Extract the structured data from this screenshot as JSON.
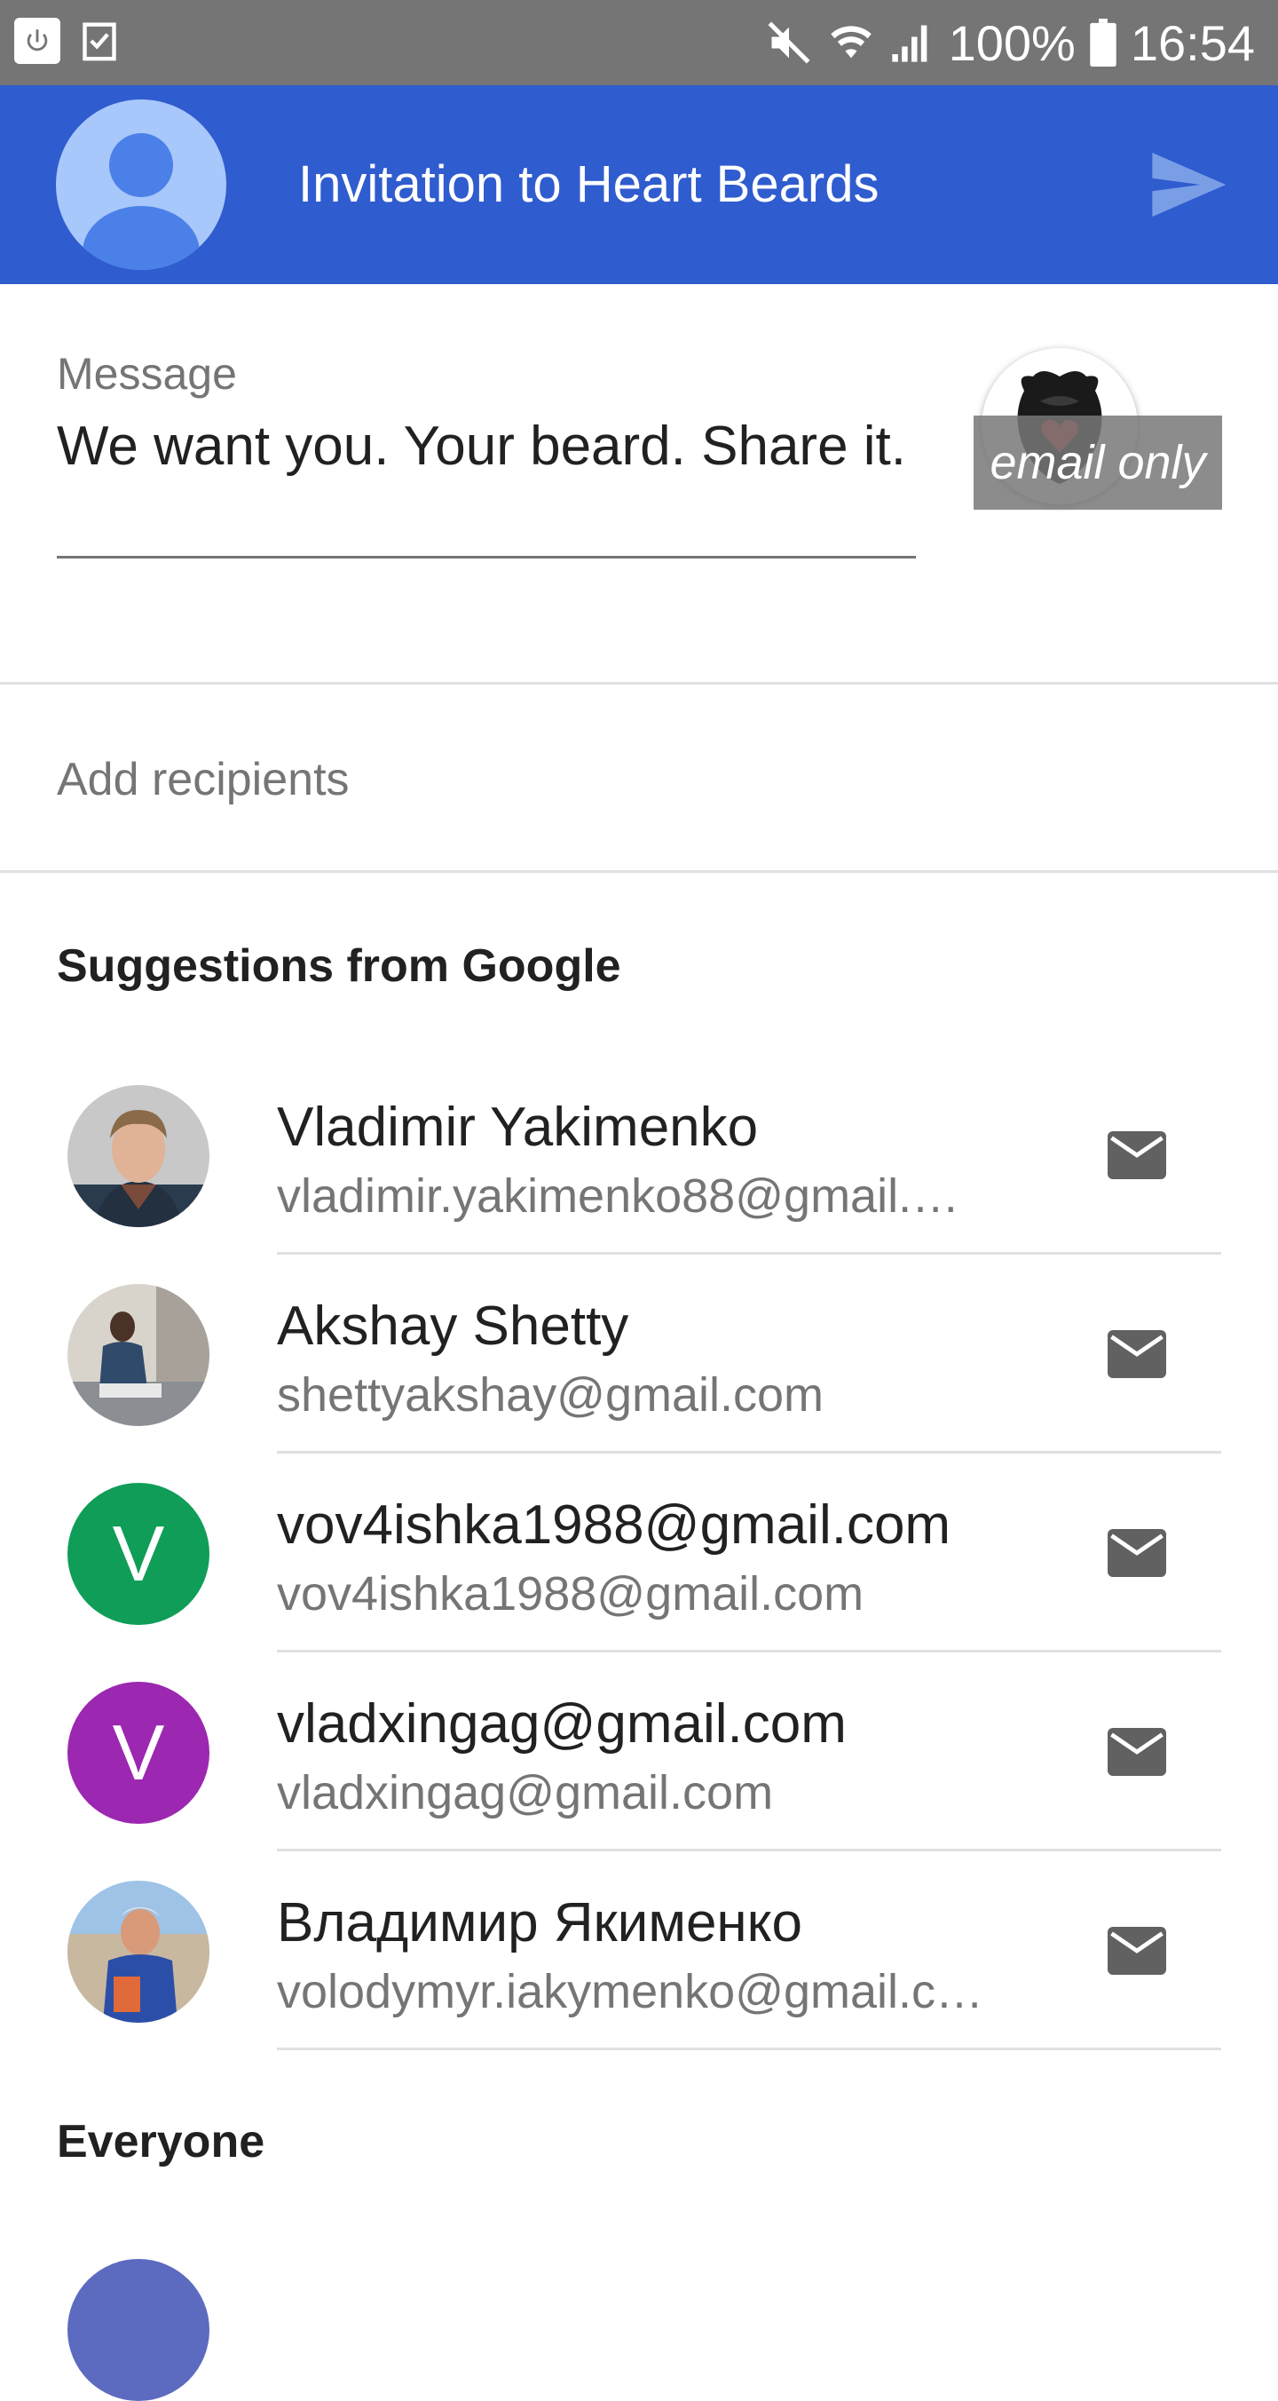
{
  "status_bar": {
    "battery": "100%",
    "time": "16:54",
    "icons": [
      "power-icon",
      "checklist-icon",
      "mute-icon",
      "wifi-icon",
      "signal-icon",
      "battery-icon"
    ]
  },
  "app_bar": {
    "title": "Invitation to Heart Beards",
    "background": "#2f5cce"
  },
  "message": {
    "label": "Message",
    "value": "We want you. Your beard. Share it."
  },
  "badge": {
    "label": "email only"
  },
  "recipients": {
    "placeholder": "Add recipients"
  },
  "suggestions": {
    "title": "Suggestions from Google",
    "contacts": [
      {
        "name": "Vladimir Yakimenko",
        "email": "vladimir.yakimenko88@gmail.…",
        "avatar": "photo"
      },
      {
        "name": "Akshay Shetty",
        "email": "shettyakshay@gmail.com",
        "avatar": "photo"
      },
      {
        "name": "vov4ishka1988@gmail.com",
        "email": "vov4ishka1988@gmail.com",
        "avatar": "letter",
        "letter": "V",
        "color": "#0f9d58"
      },
      {
        "name": "vladxingag@gmail.com",
        "email": "vladxingag@gmail.com",
        "avatar": "letter",
        "letter": "V",
        "color": "#9c27b0"
      },
      {
        "name": "Владимир Якименко",
        "email": "volodymyr.iakymenko@gmail.c…",
        "avatar": "photo"
      }
    ]
  },
  "everyone": {
    "title": "Everyone"
  }
}
